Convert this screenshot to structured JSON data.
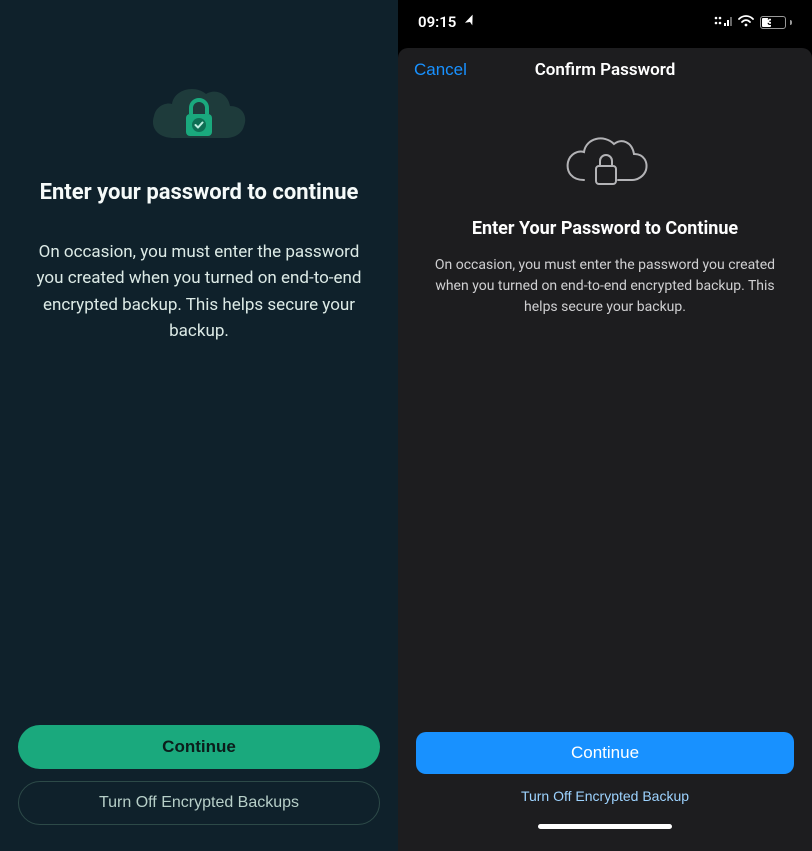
{
  "left": {
    "title": "Enter your password to continue",
    "body": "On occasion, you must enter the password you created when you turned on end-to-end encrypted backup. This helps secure your backup.",
    "continue_label": "Continue",
    "turnoff_label": "Turn Off Encrypted Backups",
    "icon": "cloud-lock-check-icon",
    "colors": {
      "bg": "#0f212b",
      "accent": "#1aa97d"
    }
  },
  "right": {
    "status": {
      "time": "09:15",
      "location_arrow": "➤",
      "battery_pct": "39"
    },
    "nav": {
      "cancel_label": "Cancel",
      "title": "Confirm Password"
    },
    "title": "Enter Your Password to Continue",
    "body": "On occasion, you must enter the password you created when you turned on end-to-end encrypted backup. This helps secure your backup.",
    "continue_label": "Continue",
    "turnoff_label": "Turn Off Encrypted Backup",
    "icon": "cloud-lock-outline-icon",
    "colors": {
      "sheet_bg": "#1d1d1f",
      "accent": "#1891ff"
    }
  }
}
